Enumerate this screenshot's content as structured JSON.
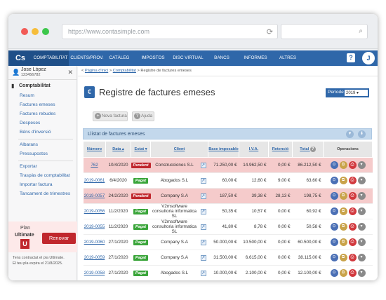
{
  "browser": {
    "url": "https://www.contasimple.com"
  },
  "nav": {
    "logo": "Cs",
    "items": [
      "COMPTABILITAT",
      "CLIENTS/PROV.",
      "CATÀLEG",
      "IMPOSTOS",
      "DISC VIRTUAL",
      "BANCS",
      "INFORMES",
      "ALTRES"
    ],
    "help": "?",
    "avatar": "J"
  },
  "user": {
    "name": "Jose López",
    "id": "123456782"
  },
  "sidebar": {
    "section": "Comptabilitat",
    "group1": [
      "Resum",
      "Factures emeses",
      "Factures rebudes",
      "Despeses",
      "Béns d'inversió"
    ],
    "group2": [
      "Albarans",
      "Pressupostos"
    ],
    "group3": [
      "Exportar",
      "Traspàs de comptabilitat",
      "Importar factura",
      "Tancament de trimestres"
    ]
  },
  "plan": {
    "label": "Plan",
    "name": "Ultimate",
    "letter": "U",
    "renew": "Renovar",
    "info1": "Tens contractat el pla Ultimate.",
    "info2": "El teu pla expira el 21/8/2025."
  },
  "breadcrumb": {
    "home": "Pàgina d'inici",
    "section": "Comptabilitat",
    "current": "Registre de factures emeses"
  },
  "page": {
    "title": "Registre de factures emeses",
    "period_label": "Període",
    "period_value": "2019"
  },
  "buttons": {
    "new": "Nova factura",
    "help": "Ajuda"
  },
  "list": {
    "title": "Llistat de factures emeses"
  },
  "columns": [
    "Número",
    "Data",
    "Estat",
    "Client",
    "Base imposable",
    "I.V.A.",
    "Retenció",
    "Total",
    "Operacions"
  ],
  "rows": [
    {
      "num": "762",
      "date": "10/4/2020",
      "status": "Pendent",
      "client": "Construcciones S.L",
      "base": "71.250,00 €",
      "iva": "14.962,50 €",
      "ret": "0,00 €",
      "total": "86.212,50 €"
    },
    {
      "num": "2019-0061",
      "date": "6/4/2020",
      "status": "Pagat",
      "client": "Abogados S.L",
      "base": "60,00 €",
      "iva": "12,60 €",
      "ret": "9,00 €",
      "total": "63,60 €"
    },
    {
      "num": "2019-0057",
      "date": "24/2/2020",
      "status": "Pendent",
      "client": "Company S.A",
      "base": "187,50 €",
      "iva": "39,38 €",
      "ret": "28,13 €",
      "total": "198,75 €"
    },
    {
      "num": "2019-0056",
      "date": "11/2/2020",
      "status": "Pagat",
      "client": "V2msoftware consultoria informatica SL",
      "base": "50,35 €",
      "iva": "10,57 €",
      "ret": "0,00 €",
      "total": "60,92 €"
    },
    {
      "num": "2019-0055",
      "date": "11/2/2020",
      "status": "Pagat",
      "client": "V2msoftware consultoria informatica SL",
      "base": "41,80 €",
      "iva": "8,78 €",
      "ret": "0,00 €",
      "total": "50,58 €"
    },
    {
      "num": "2019-0060",
      "date": "27/1/2020",
      "status": "Pagat",
      "client": "Company S.A",
      "base": "50.000,00 €",
      "iva": "10.500,00 €",
      "ret": "0,00 €",
      "total": "60.500,00 €"
    },
    {
      "num": "2019-0059",
      "date": "27/1/2020",
      "status": "Pagat",
      "client": "Company S.A",
      "base": "31.500,00 €",
      "iva": "6.615,00 €",
      "ret": "0,00 €",
      "total": "38.115,00 €"
    },
    {
      "num": "2019-0058",
      "date": "27/1/2020",
      "status": "Pagat",
      "client": "Abogados S.L",
      "base": "10.000,00 €",
      "iva": "2.100,00 €",
      "ret": "0,00 €",
      "total": "12.100,00 €"
    }
  ],
  "colors": {
    "brand": "#2f67a9",
    "pending": "#c0272d",
    "paid": "#3aa53a",
    "pending_row": "#f5cbcb"
  },
  "icons": {
    "ops": [
      "attach-icon",
      "duplicate-icon",
      "print-icon",
      "more-icon"
    ]
  }
}
